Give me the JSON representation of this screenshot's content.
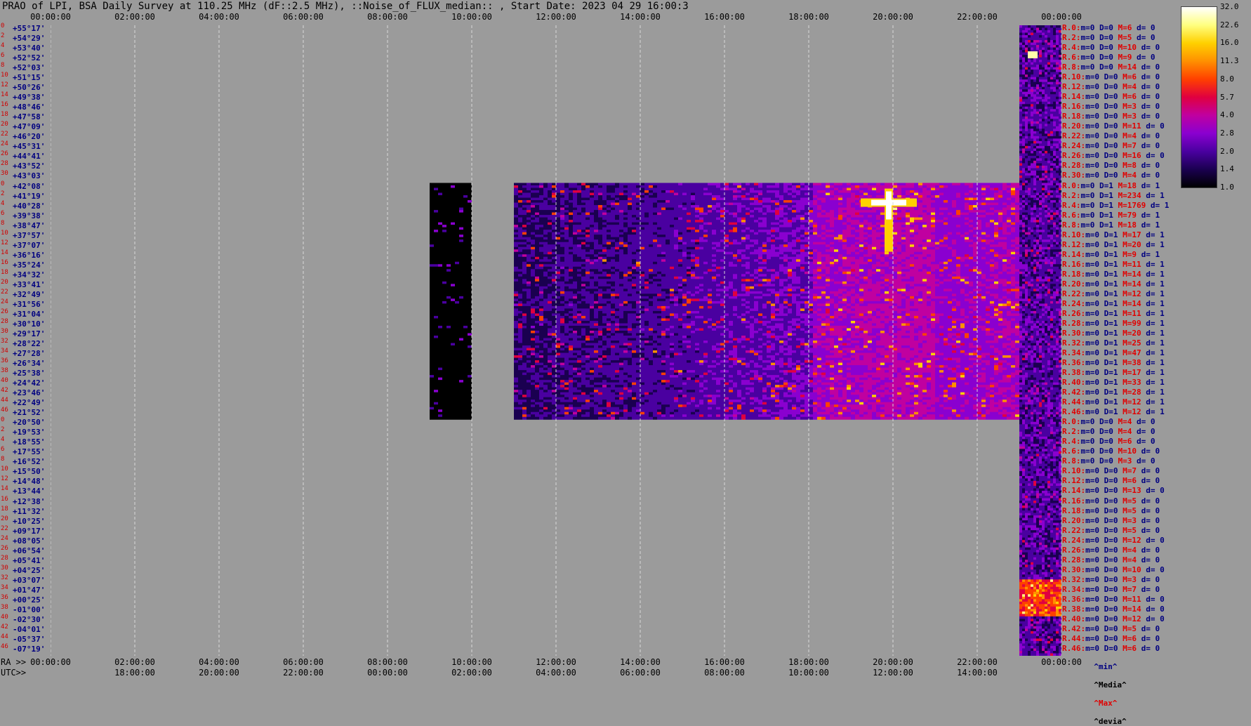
{
  "title": "PRAO of LPI, BSA Daily Survey at 110.25 MHz (dF::2.5 MHz), ::Noise_of_FLUX_median:: , Start Date: 2023 04 29 16:00:3",
  "chart_data": {
    "type": "heatmap",
    "title": "PRAO of LPI, BSA Daily Survey at 110.25 MHz (dF::2.5 MHz), ::Noise_of_FLUX_median:: , Start Date: 2023 04 29 16:00:3",
    "top_ticks": [
      "00:00:00",
      "02:00:00",
      "04:00:00",
      "06:00:00",
      "08:00:00",
      "10:00:00",
      "12:00:00",
      "14:00:00",
      "16:00:00",
      "18:00:00",
      "20:00:00",
      "22:00:00",
      "00:00:00"
    ],
    "ra_prefix": "RA >>",
    "ra_ticks": [
      "00:00:00",
      "02:00:00",
      "04:00:00",
      "06:00:00",
      "08:00:00",
      "10:00:00",
      "12:00:00",
      "14:00:00",
      "16:00:00",
      "18:00:00",
      "20:00:00",
      "22:00:00",
      "00:00:00"
    ],
    "utc_prefix": "UTC>>",
    "utc_ticks": [
      "18:00:00",
      "20:00:00",
      "22:00:00",
      "00:00:00",
      "02:00:00",
      "04:00:00",
      "06:00:00",
      "08:00:00",
      "10:00:00",
      "12:00:00",
      "14:00:00"
    ],
    "declinations": [
      "+55°17'",
      "+54°29'",
      "+53°40'",
      "+52°52'",
      "+52°03'",
      "+51°15'",
      "+50°26'",
      "+49°38'",
      "+48°46'",
      "+47°58'",
      "+47°09'",
      "+46°20'",
      "+45°31'",
      "+44°41'",
      "+43°52'",
      "+43°03'",
      "+42°08'",
      "+41°19'",
      "+40°28'",
      "+39°38'",
      "+38°47'",
      "+37°57'",
      "+37°07'",
      "+36°16'",
      "+35°24'",
      "+34°32'",
      "+33°41'",
      "+32°49'",
      "+31°56'",
      "+31°04'",
      "+30°10'",
      "+29°17'",
      "+28°22'",
      "+27°28'",
      "+26°34'",
      "+25°38'",
      "+24°42'",
      "+23°46'",
      "+22°49'",
      "+21°52'",
      "+20°50'",
      "+19°53'",
      "+18°55'",
      "+17°55'",
      "+16°52'",
      "+15°50'",
      "+14°48'",
      "+13°44'",
      "+12°38'",
      "+11°32'",
      "+10°25'",
      "+09°17'",
      "+08°05'",
      "+06°54'",
      "+05°41'",
      "+04°25'",
      "+03°07'",
      "+01°47'",
      "+00°25'",
      "-01°00'",
      "-02°30'",
      "-04°01'",
      "-05°37'",
      "-07°19'"
    ],
    "row_indices": [
      "0",
      "2",
      "4",
      "6",
      "8",
      "10",
      "12",
      "14",
      "16",
      "18",
      "20",
      "22",
      "24",
      "26",
      "28",
      "30",
      "0",
      "2",
      "4",
      "6",
      "8",
      "10",
      "12",
      "14",
      "16",
      "18",
      "20",
      "22",
      "24",
      "26",
      "28",
      "30",
      "32",
      "34",
      "36",
      "38",
      "40",
      "42",
      "44",
      "46",
      "0",
      "2",
      "4",
      "6",
      "8",
      "10",
      "12",
      "14",
      "16",
      "18",
      "20",
      "22",
      "24",
      "26",
      "28",
      "30",
      "32",
      "34",
      "36",
      "38",
      "40",
      "42",
      "44",
      "46"
    ],
    "row_stats": [
      {
        "r": "R.0:",
        "m": "m=0",
        "d": "D=0",
        "M": "M=6",
        "dv": "d= 0"
      },
      {
        "r": "R.2:",
        "m": "m=0",
        "d": "D=0",
        "M": "M=5",
        "dv": "d= 0"
      },
      {
        "r": "R.4:",
        "m": "m=0",
        "d": "D=0",
        "M": "M=10",
        "dv": "d= 0"
      },
      {
        "r": "R.6:",
        "m": "m=0",
        "d": "D=0",
        "M": "M=9",
        "dv": "d= 0"
      },
      {
        "r": "R.8:",
        "m": "m=0",
        "d": "D=0",
        "M": "M=14",
        "dv": "d= 0"
      },
      {
        "r": "R.10:",
        "m": "m=0",
        "d": "D=0",
        "M": "M=6",
        "dv": "d= 0"
      },
      {
        "r": "R.12:",
        "m": "m=0",
        "d": "D=0",
        "M": "M=4",
        "dv": "d= 0"
      },
      {
        "r": "R.14:",
        "m": "m=0",
        "d": "D=0",
        "M": "M=6",
        "dv": "d= 0"
      },
      {
        "r": "R.16:",
        "m": "m=0",
        "d": "D=0",
        "M": "M=3",
        "dv": "d= 0"
      },
      {
        "r": "R.18:",
        "m": "m=0",
        "d": "D=0",
        "M": "M=3",
        "dv": "d= 0"
      },
      {
        "r": "R.20:",
        "m": "m=0",
        "d": "D=0",
        "M": "M=11",
        "dv": "d= 0"
      },
      {
        "r": "R.22:",
        "m": "m=0",
        "d": "D=0",
        "M": "M=4",
        "dv": "d= 0"
      },
      {
        "r": "R.24:",
        "m": "m=0",
        "d": "D=0",
        "M": "M=7",
        "dv": "d= 0"
      },
      {
        "r": "R.26:",
        "m": "m=0",
        "d": "D=0",
        "M": "M=16",
        "dv": "d= 0"
      },
      {
        "r": "R.28:",
        "m": "m=0",
        "d": "D=0",
        "M": "M=8",
        "dv": "d= 0"
      },
      {
        "r": "R.30:",
        "m": "m=0",
        "d": "D=0",
        "M": "M=4",
        "dv": "d= 0"
      },
      {
        "r": "R.0:",
        "m": "m=0",
        "d": "D=1",
        "M": "M=18",
        "dv": "d= 1"
      },
      {
        "r": "R.2:",
        "m": "m=0",
        "d": "D=1",
        "M": "M=234",
        "dv": "d= 1"
      },
      {
        "r": "R.4:",
        "m": "m=0",
        "d": "D=1",
        "M": "M=1769",
        "dv": "d= 1"
      },
      {
        "r": "R.6:",
        "m": "m=0",
        "d": "D=1",
        "M": "M=79",
        "dv": "d= 1"
      },
      {
        "r": "R.8:",
        "m": "m=0",
        "d": "D=1",
        "M": "M=18",
        "dv": "d= 1"
      },
      {
        "r": "R.10:",
        "m": "m=0",
        "d": "D=1",
        "M": "M=17",
        "dv": "d= 1"
      },
      {
        "r": "R.12:",
        "m": "m=0",
        "d": "D=1",
        "M": "M=20",
        "dv": "d= 1"
      },
      {
        "r": "R.14:",
        "m": "m=0",
        "d": "D=1",
        "M": "M=9",
        "dv": "d= 1"
      },
      {
        "r": "R.16:",
        "m": "m=0",
        "d": "D=1",
        "M": "M=11",
        "dv": "d= 1"
      },
      {
        "r": "R.18:",
        "m": "m=0",
        "d": "D=1",
        "M": "M=14",
        "dv": "d= 1"
      },
      {
        "r": "R.20:",
        "m": "m=0",
        "d": "D=1",
        "M": "M=14",
        "dv": "d= 1"
      },
      {
        "r": "R.22:",
        "m": "m=0",
        "d": "D=1",
        "M": "M=12",
        "dv": "d= 1"
      },
      {
        "r": "R.24:",
        "m": "m=0",
        "d": "D=1",
        "M": "M=14",
        "dv": "d= 1"
      },
      {
        "r": "R.26:",
        "m": "m=0",
        "d": "D=1",
        "M": "M=11",
        "dv": "d= 1"
      },
      {
        "r": "R.28:",
        "m": "m=0",
        "d": "D=1",
        "M": "M=99",
        "dv": "d= 1"
      },
      {
        "r": "R.30:",
        "m": "m=0",
        "d": "D=1",
        "M": "M=20",
        "dv": "d= 1"
      },
      {
        "r": "R.32:",
        "m": "m=0",
        "d": "D=1",
        "M": "M=25",
        "dv": "d= 1"
      },
      {
        "r": "R.34:",
        "m": "m=0",
        "d": "D=1",
        "M": "M=47",
        "dv": "d= 1"
      },
      {
        "r": "R.36:",
        "m": "m=0",
        "d": "D=1",
        "M": "M=38",
        "dv": "d= 1"
      },
      {
        "r": "R.38:",
        "m": "m=0",
        "d": "D=1",
        "M": "M=17",
        "dv": "d= 1"
      },
      {
        "r": "R.40:",
        "m": "m=0",
        "d": "D=1",
        "M": "M=33",
        "dv": "d= 1"
      },
      {
        "r": "R.42:",
        "m": "m=0",
        "d": "D=1",
        "M": "M=28",
        "dv": "d= 1"
      },
      {
        "r": "R.44:",
        "m": "m=0",
        "d": "D=1",
        "M": "M=12",
        "dv": "d= 1"
      },
      {
        "r": "R.46:",
        "m": "m=0",
        "d": "D=1",
        "M": "M=12",
        "dv": "d= 1"
      },
      {
        "r": "R.0:",
        "m": "m=0",
        "d": "D=0",
        "M": "M=4",
        "dv": "d= 0"
      },
      {
        "r": "R.2:",
        "m": "m=0",
        "d": "D=0",
        "M": "M=4",
        "dv": "d= 0"
      },
      {
        "r": "R.4:",
        "m": "m=0",
        "d": "D=0",
        "M": "M=6",
        "dv": "d= 0"
      },
      {
        "r": "R.6:",
        "m": "m=0",
        "d": "D=0",
        "M": "M=10",
        "dv": "d= 0"
      },
      {
        "r": "R.8:",
        "m": "m=0",
        "d": "D=0",
        "M": "M=3",
        "dv": "d= 0"
      },
      {
        "r": "R.10:",
        "m": "m=0",
        "d": "D=0",
        "M": "M=7",
        "dv": "d= 0"
      },
      {
        "r": "R.12:",
        "m": "m=0",
        "d": "D=0",
        "M": "M=6",
        "dv": "d= 0"
      },
      {
        "r": "R.14:",
        "m": "m=0",
        "d": "D=0",
        "M": "M=13",
        "dv": "d= 0"
      },
      {
        "r": "R.16:",
        "m": "m=0",
        "d": "D=0",
        "M": "M=5",
        "dv": "d= 0"
      },
      {
        "r": "R.18:",
        "m": "m=0",
        "d": "D=0",
        "M": "M=5",
        "dv": "d= 0"
      },
      {
        "r": "R.20:",
        "m": "m=0",
        "d": "D=0",
        "M": "M=3",
        "dv": "d= 0"
      },
      {
        "r": "R.22:",
        "m": "m=0",
        "d": "D=0",
        "M": "M=5",
        "dv": "d= 0"
      },
      {
        "r": "R.24:",
        "m": "m=0",
        "d": "D=0",
        "M": "M=12",
        "dv": "d= 0"
      },
      {
        "r": "R.26:",
        "m": "m=0",
        "d": "D=0",
        "M": "M=4",
        "dv": "d= 0"
      },
      {
        "r": "R.28:",
        "m": "m=0",
        "d": "D=0",
        "M": "M=4",
        "dv": "d= 0"
      },
      {
        "r": "R.30:",
        "m": "m=0",
        "d": "D=0",
        "M": "M=10",
        "dv": "d= 0"
      },
      {
        "r": "R.32:",
        "m": "m=0",
        "d": "D=0",
        "M": "M=3",
        "dv": "d= 0"
      },
      {
        "r": "R.34:",
        "m": "m=0",
        "d": "D=0",
        "M": "M=7",
        "dv": "d= 0"
      },
      {
        "r": "R.36:",
        "m": "m=0",
        "d": "D=0",
        "M": "M=11",
        "dv": "d= 0"
      },
      {
        "r": "R.38:",
        "m": "m=0",
        "d": "D=0",
        "M": "M=14",
        "dv": "d= 0"
      },
      {
        "r": "R.40:",
        "m": "m=0",
        "d": "D=0",
        "M": "M=12",
        "dv": "d= 0"
      },
      {
        "r": "R.42:",
        "m": "m=0",
        "d": "D=0",
        "M": "M=5",
        "dv": "d= 0"
      },
      {
        "r": "R.44:",
        "m": "m=0",
        "d": "D=0",
        "M": "M=6",
        "dv": "d= 0"
      },
      {
        "r": "R.46:",
        "m": "m=0",
        "d": "D=0",
        "M": "M=6",
        "dv": "d= 0"
      }
    ],
    "stat_keys": {
      "min": "^min^",
      "median": "^Media^",
      "max": "^Max^",
      "dev": "^devia^"
    },
    "colorbar_ticks": [
      "32.0",
      "22.6",
      "16.0",
      "11.3",
      "8.0",
      "5.7",
      "4.0",
      "2.8",
      "2.0",
      "1.4",
      "1.0"
    ],
    "colormap": [
      "#000000",
      "#1a0050",
      "#4a00a0",
      "#8a00d0",
      "#c000a0",
      "#e00040",
      "#ff4000",
      "#ff9000",
      "#ffd000",
      "#ffff80",
      "#ffffff"
    ],
    "data_blocks": [
      {
        "name": "block-a",
        "time_start_h": 0.0,
        "time_end_h": 24.0,
        "rows": "0-63 (col at RA 23:00-24:00)",
        "level": "medium"
      },
      {
        "name": "block-b",
        "time_start_h": 9.0,
        "time_end_h": 10.0,
        "rows": "16-39",
        "level": "low"
      },
      {
        "name": "block-c",
        "time_start_h": 11.0,
        "time_end_h": 23.0,
        "rows": "16-39",
        "level": "medium-high"
      }
    ],
    "hotspots": [
      {
        "ra_h": 19.9,
        "row": 18,
        "value": "max"
      },
      {
        "ra_h": 23.3,
        "row": 3,
        "value": "high"
      },
      {
        "ra_h": 23.5,
        "row": 58,
        "value": "high"
      }
    ]
  }
}
